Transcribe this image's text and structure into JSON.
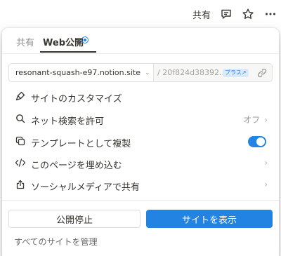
{
  "topbar": {
    "share_label": "共有",
    "icons": [
      "comment-icon",
      "star-icon",
      "more-icon"
    ]
  },
  "popover": {
    "tabs": [
      {
        "label": "共有",
        "active": false
      },
      {
        "label": "Web公開",
        "active": true
      }
    ],
    "url": {
      "domain": "resonant-squash-e97.notion.site",
      "slug": "/ 20f824d38392...",
      "plus_badge": "プラス↗"
    },
    "menu": [
      {
        "label": "サイトのカスタマイズ",
        "icon": "paint-brush-icon"
      },
      {
        "label": "ネット検索を許可",
        "icon": "search-icon",
        "value": "オフ"
      },
      {
        "label": "テンプレートとして複製",
        "icon": "duplicate-icon",
        "toggle_on": true
      },
      {
        "label": "このページを埋め込む",
        "icon": "embed-code-icon"
      },
      {
        "label": "ソーシャルメディアで共有",
        "icon": "share-upload-icon"
      }
    ],
    "buttons": {
      "unpublish": "公開停止",
      "view_site": "サイトを表示"
    },
    "manage_all": "すべてのサイトを管理"
  },
  "colors": {
    "accent": "#2383e2",
    "text": "#37352f",
    "muted": "#9b9a97"
  }
}
